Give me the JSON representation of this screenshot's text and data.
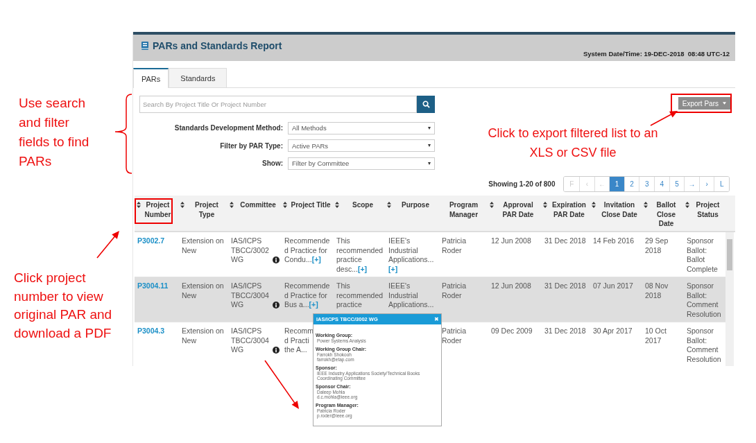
{
  "header": {
    "title": "PARs and Standards Report",
    "system_time": "System Date/Time: 19-DEC-2018  08:48 UTC-12"
  },
  "tabs": [
    {
      "label": "PARs",
      "selected": true
    },
    {
      "label": "Standards",
      "selected": false
    }
  ],
  "search": {
    "placeholder": "Search By Project Title Or Project Number"
  },
  "filters": [
    {
      "label": "Standards Development Method:",
      "value": "All Methods"
    },
    {
      "label": "Filter by PAR Type:",
      "value": "Active PARs"
    },
    {
      "label": "Show:",
      "value": "Filter by Committee"
    }
  ],
  "export_button": {
    "label": "Export Pars"
  },
  "pagination": {
    "summary": "Showing 1-20 of 800",
    "pages": [
      {
        "label": "F",
        "selected": false,
        "disabled": true
      },
      {
        "label": "‹",
        "selected": false,
        "disabled": true
      },
      {
        "label": "←",
        "selected": false,
        "disabled": true
      },
      {
        "label": "1",
        "selected": true,
        "disabled": false
      },
      {
        "label": "2",
        "selected": false,
        "disabled": false
      },
      {
        "label": "3",
        "selected": false,
        "disabled": false
      },
      {
        "label": "4",
        "selected": false,
        "disabled": false
      },
      {
        "label": "5",
        "selected": false,
        "disabled": false
      },
      {
        "label": "→",
        "selected": false,
        "disabled": false
      },
      {
        "label": "›",
        "selected": false,
        "disabled": false
      },
      {
        "label": "L",
        "selected": false,
        "disabled": false
      }
    ]
  },
  "table": {
    "columns": [
      {
        "label": "Project Number",
        "sortable": true
      },
      {
        "label": "Project Type",
        "sortable": true
      },
      {
        "label": "Committee",
        "sortable": true
      },
      {
        "label": "Project Title",
        "sortable": true
      },
      {
        "label": "Scope",
        "sortable": true
      },
      {
        "label": "Purpose",
        "sortable": true
      },
      {
        "label": "Program Manager",
        "sortable": false
      },
      {
        "label": "Approval PAR Date",
        "sortable": true
      },
      {
        "label": "Expiration PAR Date",
        "sortable": true
      },
      {
        "label": "Invitation Close Date",
        "sortable": true
      },
      {
        "label": "Ballot Close Date",
        "sortable": true
      },
      {
        "label": "Project Status",
        "sortable": true
      }
    ],
    "rows": [
      {
        "selected": false,
        "number": "P3002.7",
        "type": "Extension on New",
        "committee": "IAS/ICPS TBCC/3002 WG",
        "title": {
          "text": "Recommended Practice for Condu...",
          "more": "[+]"
        },
        "scope": {
          "text": "This recommended practice desc...",
          "more": "[+]"
        },
        "purpose": {
          "text": "IEEE's Industrial Applications...",
          "more": "[+]"
        },
        "manager": "Patricia Roder",
        "approval": "12 Jun 2008",
        "expiration": "31 Dec 2018",
        "invitation": "14 Feb 2016",
        "ballot": "29 Sep 2018",
        "status": "Sponsor Ballot: Ballot Complete"
      },
      {
        "selected": true,
        "number": "P3004.11",
        "type": "Extension on New",
        "committee": "IAS/ICPS TBCC/3004 WG",
        "title": {
          "text": "Recommended Practice for Bus a...",
          "more": "[+]"
        },
        "scope": {
          "text": "This recommended practice"
        },
        "purpose": {
          "text": "IEEE's Industrial Applications..."
        },
        "manager": "Patricia Roder",
        "approval": "12 Jun 2008",
        "expiration": "31 Dec 2018",
        "invitation": "07 Jun 2017",
        "ballot": "08 Nov 2018",
        "status": "Sponsor Ballot: Comment Resolution"
      },
      {
        "selected": false,
        "number": "P3004.3",
        "type": "Extension on New",
        "committee": "IAS/ICPS TBCC/3004 WG",
        "title": {
          "lines": [
            "Recomm",
            "d Practi",
            "the A..."
          ]
        },
        "manager": "Patricia Roder",
        "approval": "09 Dec 2009",
        "expiration": "31 Dec 2018",
        "invitation": "30 Apr 2017",
        "ballot": "10 Oct 2017",
        "status": "Sponsor Ballot: Comment Resolution"
      }
    ]
  },
  "popup": {
    "title": "IAS/ICPS TBCC/3002 WG",
    "close": "✖",
    "sections": [
      {
        "label": "Working Group:",
        "lines": [
          "Power Systems Analysis"
        ]
      },
      {
        "label": "Working Group Chair:",
        "lines": [
          "Farrokh Shokooh",
          "farrokh@etap.com"
        ]
      },
      {
        "label": "Sponsor:",
        "lines": [
          "IEEE Industry Applications Society/Technical Books Coordinating Committee"
        ]
      },
      {
        "label": "Sponsor Chair:",
        "lines": [
          "Daleep Mohla",
          "d.c.mohla@ieee.org"
        ]
      },
      {
        "label": "Program Manager:",
        "lines": [
          "Patricia Roder",
          "p.roder@ieee.org"
        ]
      }
    ]
  },
  "annotations": [
    {
      "kind": "search",
      "text": "Use search and filter fields to find PARs"
    },
    {
      "kind": "project",
      "text": "Click project number to view original PAR and download a PDF"
    },
    {
      "kind": "export",
      "text": "Click to export filtered list to an XLS or CSV file"
    }
  ]
}
